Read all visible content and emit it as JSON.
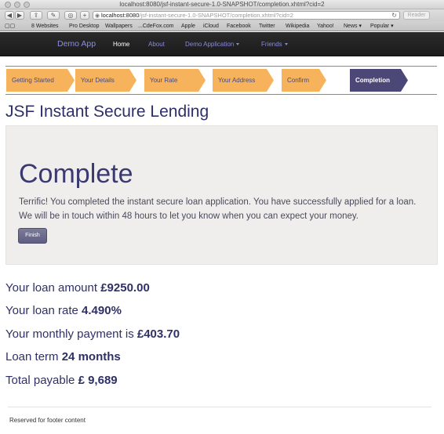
{
  "window": {
    "title": "localhost:8080/jsf-instant-secure-1.0-SNAPSHOT/completion.xhtml?cid=2"
  },
  "toolbar": {
    "url_host": "localhost:8080",
    "url_path": "/jsf-instant-secure-1.0-SNAPSHOT/completion.xhtml?cid=2",
    "reader_label": "Reader"
  },
  "bookmarks": [
    "8 Websites",
    "Pro Desktop",
    "Wallpapers",
    "...CdeFox.com",
    "Apple",
    "iCloud",
    "Facebook",
    "Twitter",
    "Wikipedia",
    "Yahoo!",
    "News",
    "Popular"
  ],
  "nav": {
    "brand": "Demo App",
    "items": [
      "Home",
      "About",
      "Demo Application",
      "Friends"
    ]
  },
  "wizard": {
    "steps": [
      "Getting Started",
      "Your Details",
      "Your Rate",
      "Your Address",
      "Confirm",
      "Completion"
    ],
    "current": "Completion"
  },
  "page": {
    "title": "JSF Instant Secure Lending"
  },
  "jumbotron": {
    "heading": "Complete",
    "text": "Terrific! You completed the instant secure loan application. You have successfully applied for a loan. We will be in touch within 48 hours to let you know when you can expect your money.",
    "button": "Finish"
  },
  "summary": {
    "amount_label": "Your loan amount",
    "amount": "£9250.00",
    "rate_label": "Your loan rate",
    "rate": "4.490%",
    "monthly_label": "Your monthly payment is",
    "monthly": "£403.70",
    "term_label": "Loan term",
    "term": "24 months",
    "total_label": "Total payable",
    "total": "£ 9,689"
  },
  "footer": {
    "text": "Reserved for footer content"
  },
  "colors": {
    "step": "#f7b35c",
    "step_current": "#4b4878",
    "title": "#2e2f6a",
    "navbar": "#1b1b1b"
  }
}
